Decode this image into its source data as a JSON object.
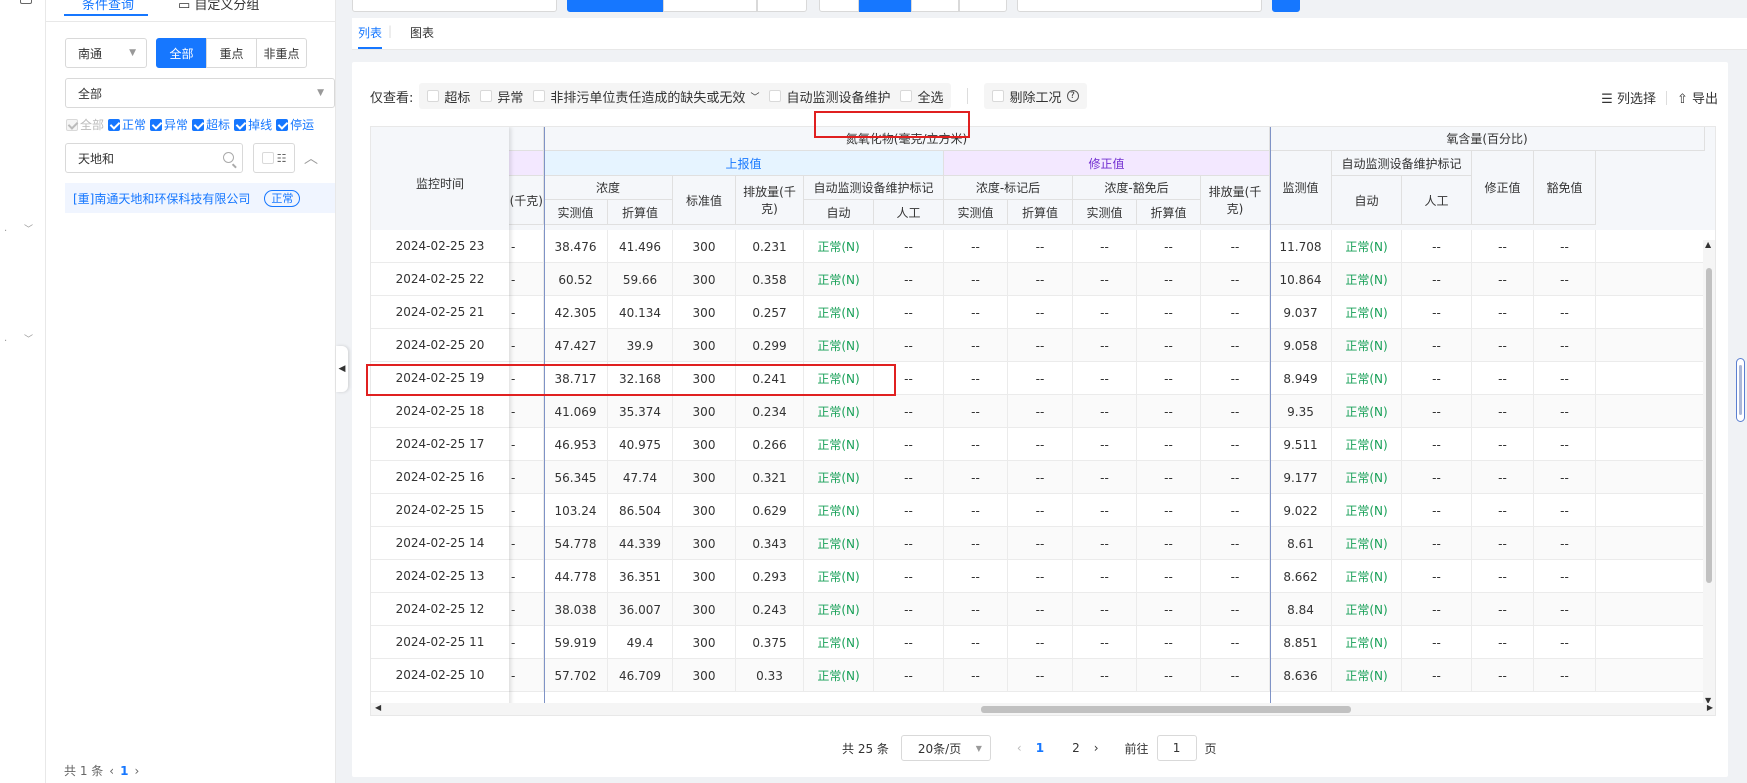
{
  "sidebar": {
    "tab_active": "条件查询",
    "tab_other": "自定义分组",
    "region": "南通",
    "segments": [
      "全部",
      "重点",
      "非重点"
    ],
    "scope": "全部",
    "status_filters": [
      {
        "label": "全部",
        "checked": true,
        "disabled": true
      },
      {
        "label": "正常",
        "checked": true
      },
      {
        "label": "异常",
        "checked": true
      },
      {
        "label": "超标",
        "checked": true
      },
      {
        "label": "掉线",
        "checked": true
      },
      {
        "label": "停运",
        "checked": true
      }
    ],
    "search_value": "天地和",
    "company": "[重]南通天地和环保科技有限公司",
    "company_status": "正常",
    "pager_total": "共 1 条",
    "pager_page": "1"
  },
  "view_tabs": [
    "列表",
    "图表"
  ],
  "filters": {
    "label": "仅查看:",
    "options": [
      "超标",
      "异常",
      "非排污单位责任造成的缺失或无效",
      "自动监测设备维护",
      "全选"
    ],
    "exclude": "剔除工况",
    "col_select": "列选择",
    "export": "导出"
  },
  "table": {
    "time_header": "监控时间",
    "partial_header": "(千克)",
    "nox_header": "氮氧化物(毫克/立方米)",
    "o2_header": "氧含量(百分比)",
    "reported": "上报值",
    "corrected": "修正值",
    "concentration": "浓度",
    "measured": "实测值",
    "converted": "折算值",
    "standard": "标准值",
    "emission": "排放量(千克)",
    "maint_mark": "自动监测设备维护标记",
    "auto": "自动",
    "manual": "人工",
    "conc_marked": "浓度-标记后",
    "conc_exempt": "浓度-豁免后",
    "monitor": "监测值",
    "fix_val": "修正值",
    "exempt_val": "豁免值",
    "rows": [
      {
        "time": "2024-02-25 23",
        "m": "38.476",
        "c": "41.496",
        "s": "300",
        "e": "0.231",
        "st": "正常(N)",
        "o2": "11.708"
      },
      {
        "time": "2024-02-25 22",
        "m": "60.52",
        "c": "59.66",
        "s": "300",
        "e": "0.358",
        "st": "正常(N)",
        "o2": "10.864"
      },
      {
        "time": "2024-02-25 21",
        "m": "42.305",
        "c": "40.134",
        "s": "300",
        "e": "0.257",
        "st": "正常(N)",
        "o2": "9.037"
      },
      {
        "time": "2024-02-25 20",
        "m": "47.427",
        "c": "39.9",
        "s": "300",
        "e": "0.299",
        "st": "正常(N)",
        "o2": "9.058"
      },
      {
        "time": "2024-02-25 19",
        "m": "38.717",
        "c": "32.168",
        "s": "300",
        "e": "0.241",
        "st": "正常(N)",
        "o2": "8.949"
      },
      {
        "time": "2024-02-25 18",
        "m": "41.069",
        "c": "35.374",
        "s": "300",
        "e": "0.234",
        "st": "正常(N)",
        "o2": "9.35"
      },
      {
        "time": "2024-02-25 17",
        "m": "46.953",
        "c": "40.975",
        "s": "300",
        "e": "0.266",
        "st": "正常(N)",
        "o2": "9.511"
      },
      {
        "time": "2024-02-25 16",
        "m": "56.345",
        "c": "47.74",
        "s": "300",
        "e": "0.321",
        "st": "正常(N)",
        "o2": "9.177"
      },
      {
        "time": "2024-02-25 15",
        "m": "103.24",
        "c": "86.504",
        "s": "300",
        "e": "0.629",
        "st": "正常(N)",
        "o2": "9.022"
      },
      {
        "time": "2024-02-25 14",
        "m": "54.778",
        "c": "44.339",
        "s": "300",
        "e": "0.343",
        "st": "正常(N)",
        "o2": "8.61"
      },
      {
        "time": "2024-02-25 13",
        "m": "44.778",
        "c": "36.351",
        "s": "300",
        "e": "0.293",
        "st": "正常(N)",
        "o2": "8.662"
      },
      {
        "time": "2024-02-25 12",
        "m": "38.038",
        "c": "36.007",
        "s": "300",
        "e": "0.243",
        "st": "正常(N)",
        "o2": "8.84"
      },
      {
        "time": "2024-02-25 11",
        "m": "59.919",
        "c": "49.4",
        "s": "300",
        "e": "0.375",
        "st": "正常(N)",
        "o2": "8.851"
      },
      {
        "time": "2024-02-25 10",
        "m": "57.702",
        "c": "46.709",
        "s": "300",
        "e": "0.33",
        "st": "正常(N)",
        "o2": "8.636"
      }
    ],
    "dash": "--"
  },
  "pagination": {
    "total": "共 25 条",
    "page_size": "20条/页",
    "pages": [
      "1",
      "2"
    ],
    "goto_label": "前往",
    "goto_value": "1",
    "page_unit": "页"
  }
}
